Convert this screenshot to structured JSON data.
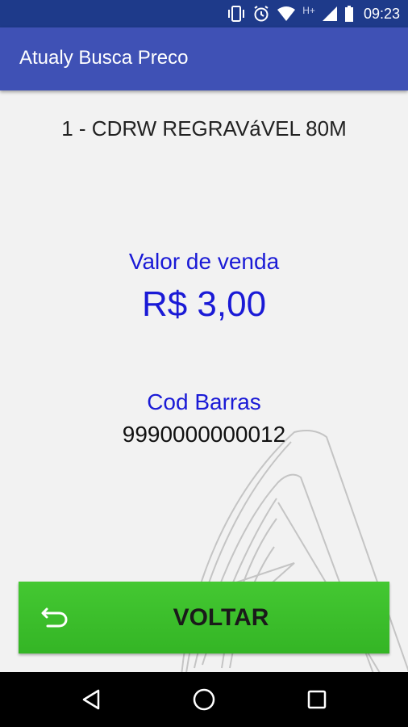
{
  "status_bar": {
    "time": "09:23",
    "network_type": "H+",
    "icons": [
      "vibrate-icon",
      "alarm-icon",
      "wifi-icon",
      "signal-icon",
      "battery-icon"
    ]
  },
  "app_bar": {
    "title": "Atualy Busca Preco"
  },
  "product": {
    "name": "1 - CDRW REGRAVáVEL 80M",
    "price_label": "Valor de venda",
    "price": "R$ 3,00",
    "barcode_label": "Cod Barras",
    "barcode": "9990000000012"
  },
  "actions": {
    "back_label": "VOLTAR",
    "back_icon": "undo-icon"
  },
  "nav_bar": {
    "icons": [
      "back-triangle-icon",
      "home-circle-icon",
      "recent-square-icon"
    ]
  },
  "colors": {
    "app_bar": "#3f51b5",
    "status_bar": "#1e3a8a",
    "accent_text": "#1a1ad6",
    "button": "#3bbf2b"
  }
}
